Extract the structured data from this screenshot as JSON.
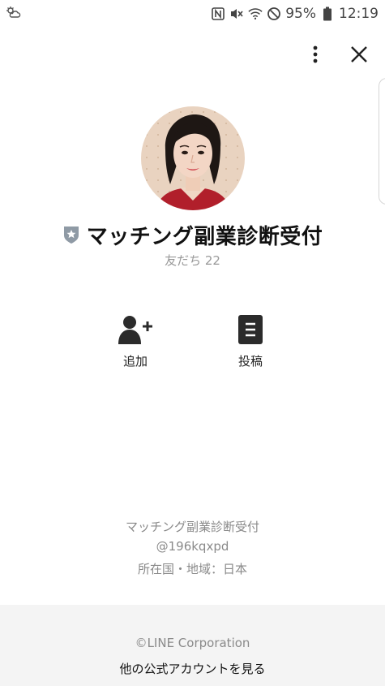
{
  "status_bar": {
    "battery_percent": "95%",
    "time": "12:19",
    "icons": [
      "weather-cloud-icon",
      "nfc-icon",
      "vibrate-mute-icon",
      "wifi-icon",
      "do-not-disturb-icon",
      "battery-icon"
    ]
  },
  "header": {
    "icons": [
      "more-vertical-icon",
      "close-icon"
    ]
  },
  "profile": {
    "name": "マッチング副業診断受付",
    "friends": "友だち 22",
    "badge_icon": "verified-star-badge-icon"
  },
  "actions": {
    "add_label": "追加",
    "post_label": "投稿"
  },
  "info": {
    "name": "マッチング副業診断受付",
    "id": "@196kqxpd",
    "region": "所在国・地域：日本"
  },
  "footer": {
    "copyright": "©LINE Corporation",
    "more_accounts": "他の公式アカウントを見る",
    "background": "#f4f4f4"
  },
  "colors": {
    "text_primary": "#111111",
    "text_secondary": "#8a8a8a",
    "icon_dark": "#2b2b2b"
  }
}
